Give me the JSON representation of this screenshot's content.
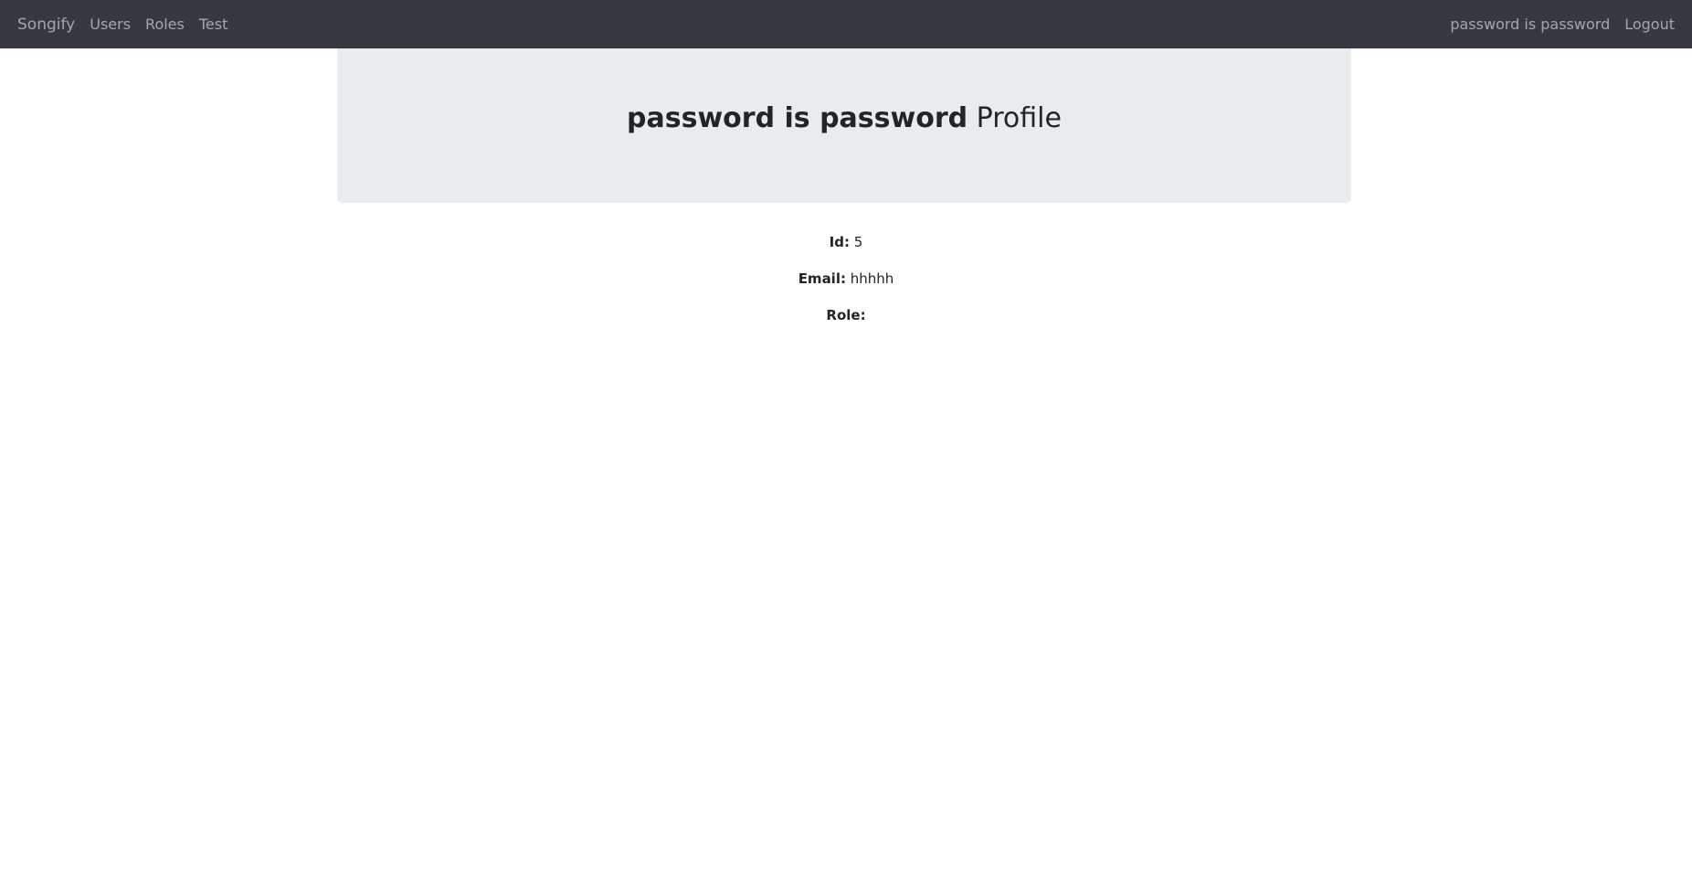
{
  "navbar": {
    "brand": "Songify",
    "links": [
      "Users",
      "Roles",
      "Test"
    ],
    "user": "password is password",
    "logout": "Logout"
  },
  "profile": {
    "name": "password is password",
    "title_suffix": "Profile",
    "fields": [
      {
        "label": "Id:",
        "value": "5"
      },
      {
        "label": "Email:",
        "value": "hhhhh"
      },
      {
        "label": "Role:",
        "value": ""
      }
    ]
  },
  "colors": {
    "navbar": "#343a40",
    "jumbotron": "#e9ecef"
  }
}
